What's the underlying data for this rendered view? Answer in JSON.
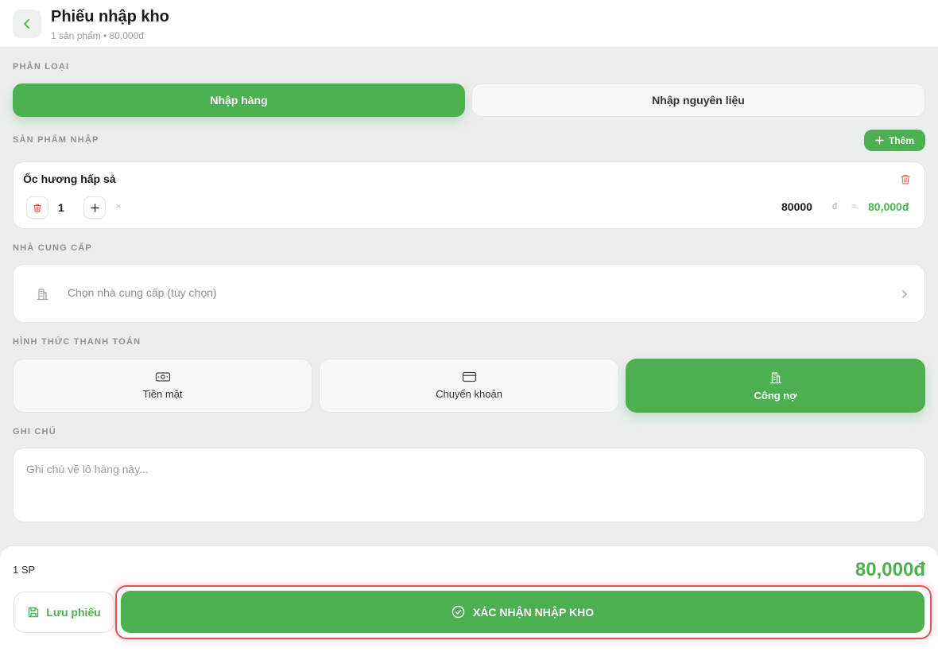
{
  "header": {
    "title": "Phiếu nhập kho",
    "subtitle": "1 sản phẩm • 80,000đ"
  },
  "category": {
    "label": "PHÂN LOẠI",
    "options": [
      "Nhập hàng",
      "Nhập nguyên liệu"
    ],
    "selected": "Nhập hàng"
  },
  "products": {
    "label": "SẢN PHẨM NHẬP",
    "add_label": "Thêm",
    "items": [
      {
        "name": "Ốc hương hấp sả",
        "quantity": "1",
        "times_sign": "×",
        "unit_price": "80000",
        "currency": "đ",
        "equals_sign": "=",
        "subtotal": "80,000đ"
      }
    ]
  },
  "supplier": {
    "label": "NHÀ CUNG CẤP",
    "placeholder": "Chọn nhà cung cấp (tùy chọn)"
  },
  "payment": {
    "label": "HÌNH THỨC THANH TOÁN",
    "options": [
      {
        "label": "Tiền mặt",
        "icon": "cash-icon"
      },
      {
        "label": "Chuyển khoản",
        "icon": "credit-card-icon"
      },
      {
        "label": "Công nợ",
        "icon": "building-icon"
      }
    ],
    "selected": "Công nợ"
  },
  "note": {
    "label": "GHI CHÚ",
    "placeholder": "Ghi chú về lô hàng này..."
  },
  "footer": {
    "count": "1 SP",
    "total": "80,000đ",
    "save_label": "Lưu phiếu",
    "confirm_label": "XÁC NHẬN NHẬP KHO"
  },
  "colors": {
    "accent": "#4caf50",
    "danger": "#e25454"
  }
}
